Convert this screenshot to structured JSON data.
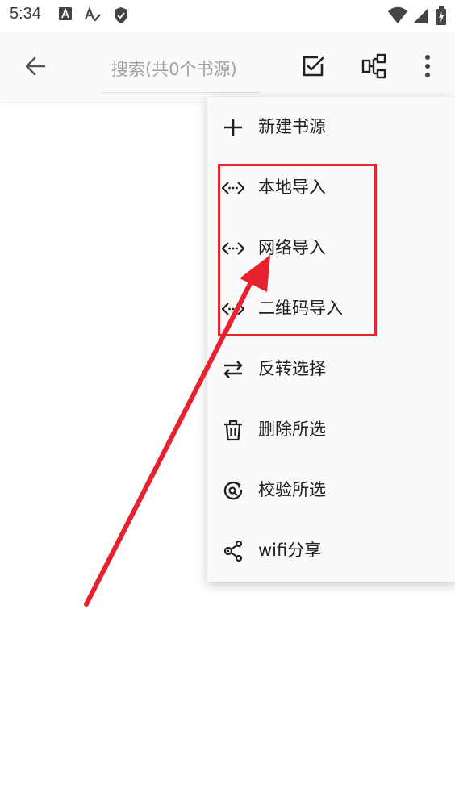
{
  "status_bar": {
    "time": "5:34",
    "left_icons": [
      "text-a-icon",
      "text-a-check-icon",
      "shield-check-icon"
    ],
    "right_icons": [
      "wifi-icon",
      "signal-icon",
      "battery-charging-icon"
    ]
  },
  "app_bar": {
    "back_icon": "arrow-back-icon",
    "search_placeholder": "搜索(共0个书源)",
    "actions": [
      "edit-checkbox-icon",
      "group-icon",
      "more-vert-icon"
    ]
  },
  "menu": {
    "items": [
      {
        "label": "新建书源",
        "icon": "plus-icon"
      },
      {
        "label": "本地导入",
        "icon": "code-icon"
      },
      {
        "label": "网络导入",
        "icon": "code-icon"
      },
      {
        "label": "二维码导入",
        "icon": "code-icon"
      },
      {
        "label": "反转选择",
        "icon": "swap-icon"
      },
      {
        "label": "删除所选",
        "icon": "delete-icon"
      },
      {
        "label": "校验所选",
        "icon": "check-source-icon"
      },
      {
        "label": "wifi分享",
        "icon": "share-icon"
      }
    ]
  },
  "annotation": {
    "color": "#e8212e"
  },
  "colors": {
    "icon": "#1f1f1f",
    "menu_bg": "#fafafa",
    "annotation": "#e8212e"
  }
}
